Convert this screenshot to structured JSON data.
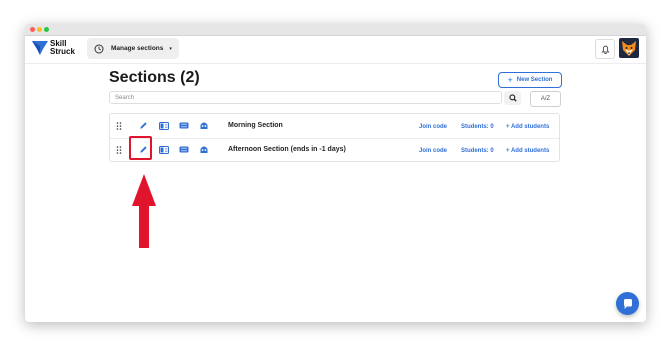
{
  "window_controls": {
    "close_color": "#ff5f57",
    "minimize_color": "#febc2e",
    "zoom_color": "#28c840"
  },
  "brand": {
    "line1": "Skill",
    "line2": "Struck",
    "color": "#2f6fd6"
  },
  "header": {
    "manage_label": "Manage sections",
    "manage_icon": "clock-icon",
    "caret": "▾",
    "bell_icon": "bell-icon",
    "avatar": "fox-avatar"
  },
  "page": {
    "title": "Sections (2)",
    "new_section_label": "New Section",
    "new_section_plus": "+"
  },
  "search": {
    "placeholder": "Search",
    "sort_label": "A/Z"
  },
  "rows": [
    {
      "title": "Morning Section",
      "join_code": "Join code",
      "students": "Students: 0",
      "add_students": "+ Add students"
    },
    {
      "title": "Afternoon Section (ends in -1 days)",
      "join_code": "Join code",
      "students": "Students: 0",
      "add_students": "+ Add students"
    }
  ],
  "row_icons": [
    "drag-handle-icon",
    "pencil-icon",
    "book-icon",
    "keyboard-icon",
    "robot-icon"
  ],
  "colors": {
    "accent": "#2f6fd6",
    "highlight": "#e0142c",
    "arrow": "#e0142c"
  }
}
